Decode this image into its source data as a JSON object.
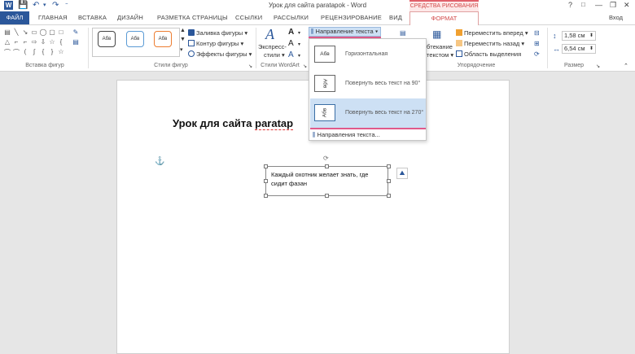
{
  "window": {
    "title": "Урок для сайта paratapok - Word",
    "context_header": "СРЕДСТВА РИСОВАНИЯ",
    "help": "?",
    "restore": "□",
    "minimize": "—",
    "maximize": "❐",
    "close": "✕"
  },
  "tabs": {
    "file": "ФАЙЛ",
    "items": [
      "ГЛАВНАЯ",
      "ВСТАВКА",
      "ДИЗАЙН",
      "РАЗМЕТКА СТРАНИЦЫ",
      "ССЫЛКИ",
      "РАССЫЛКИ",
      "РЕЦЕНЗИРОВАНИЕ",
      "ВИД"
    ],
    "format": "ФОРМАТ",
    "login": "Вход"
  },
  "ribbon": {
    "groups": {
      "insert_shapes": "Вставка фигур",
      "shape_styles": "Стили фигур",
      "wordart_styles": "Стили WordArt",
      "arrange": "Упорядочение",
      "size": "Размер"
    },
    "style_sample": "Абв",
    "fill": "Заливка фигуры",
    "outline": "Контур фигуры",
    "effects": "Эффекты фигуры",
    "express_line1": "Экспресс-",
    "express_line2": "стили",
    "text_direction": "Направление текста",
    "wrap_line1": "бтекание",
    "wrap_line2": "текстом",
    "bring_forward": "Переместить вперед",
    "send_backward": "Переместить назад",
    "selection_pane": "Область выделения",
    "height": "1,58 см",
    "width": "6,54 см"
  },
  "dropdown": {
    "items": [
      {
        "icon": "Абв",
        "label": "Горизонтальная"
      },
      {
        "icon": "Абв",
        "label": "Повернуть весь текст на 90°"
      },
      {
        "icon": "Абв",
        "label": "Повернуть весь текст на 270°"
      }
    ],
    "footer": "Направления текста..."
  },
  "document": {
    "heading_plain": "Урок для сайта ",
    "heading_err": "paratap",
    "textbox_text": "Каждый охотник желает знать, где сидит фазан"
  },
  "colors": {
    "accent": "#2b579a",
    "context": "#d24a4a",
    "highlight": "#cde0f4"
  }
}
